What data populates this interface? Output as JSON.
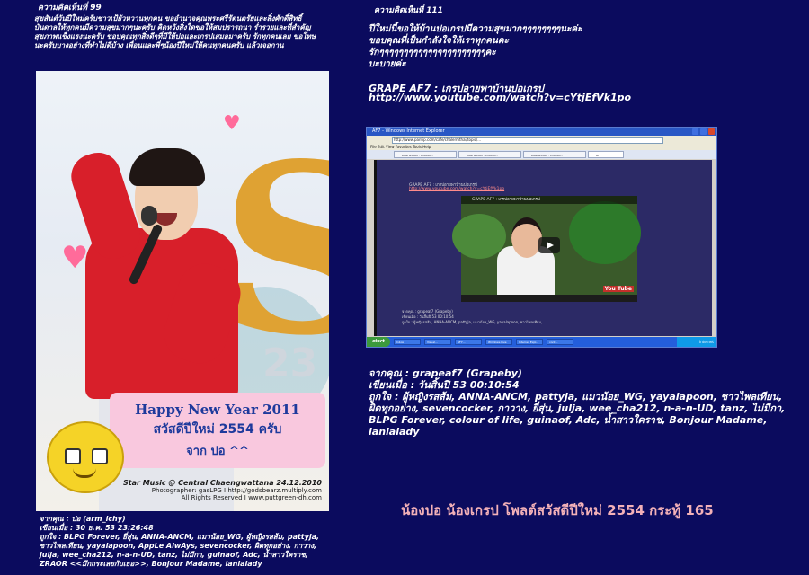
{
  "left": {
    "heading": "ความคิดเห็นที่ 99",
    "message": "สุขสันต์วันปีใหม่ครับชาวเป้ยัวหวานทุกคน ขออำนาจคุณพระศรีรัตนตรัยและสิ่งศักดิ์สิทธิ์บันดาลให้ทุกคนมีความสุขมากๆนะครับ คิดหวังสิ่งใดขอให้สมปรารถนา ร่ำรวยและที่สำคัญสุขภาพแข็งแรงนะครับ ขอบคุณทุกสิ่งดีๆที่มีให้ปอและเกรปเสมอมาครับ รักทุกคนเลย ขอโทษนะครับบางอย่างที่ทำไม่ดีบ้าง เพื่อนและพี่ๆน้องปีใหม่ให้คนทุกคนครับ แล้วเจอกาน",
    "photo": {
      "greeting_en": "Happy New Year 2011",
      "greeting_th": "สวัสดีปีใหม่ 2554 ครับ",
      "greeting_from": "จาก ปอ ^^",
      "credit_star": "Star Music @ Central Chaengwattana 24.12.2010",
      "credit_photographer": "Photographer: gasLPG I http://godsbearz.multiply.com",
      "credit_rights": "All Rights Reserved I www.puttgreen-dh.com"
    },
    "meta": [
      "จากคุณ : ปอ (arm_ichy)",
      "เขียนเมื่อ : 30 ธ.ค. 53 23:26:48",
      "ถูกใจ : BLPG Forever, ยี่สุ่น, ANNA-ANCM, แมวน้อย_WG, ผู้หญิงรสส้ม, pattyja,",
      "ชาวไพลเทียน, yayalapoon, AppLe AlwAys, sevencocker, ผิดทุกอย่าง, กาวาง,",
      "julja, wee_cha212, n-a-n-UD, tanz, ไม่มีกา, guinaof, Adc, น้ำสาวใคราช,",
      "ZRAOR <<มึกกระเลยกับเธอ>>, Bonjour Madame, lanlalady"
    ]
  },
  "right": {
    "heading": "ความคิดเห็นที่ 111",
    "message_lines": [
      "ปีใหม่นี้ขอให้บ้านปอเกรปมีความสุขมากๆๆๆๆๆๆๆๆนะค่ะ",
      "ขอบคุณที่เป็นกำลังใจให้เราทุกคนคะ",
      "รักๆๆๆๆๆๆๆๆๆๆๆๆๆๆๆๆๆๆๆๆๆๆคะ",
      "บะบายค่ะ"
    ],
    "link_title": "GRAPE AF7 : เกรปอายพาบ้านปอเกรป",
    "link_url": "http://www.youtube.com/watch?v=cYtjEfVk1po",
    "screenshot": {
      "window_title": "AF7 - Windows Internet Explorer",
      "address": "http://www.pantip.com/cafe/chalermthai/topic/...",
      "menu": "File   Edit   View   Favorites   Tools   Help",
      "tabs": [
        "PANTIP.COM : C10485...",
        "PANTIP.COM : C10485...",
        "PANTIP.COM : C10485...",
        "AF7"
      ],
      "page_title": "GRAPE AF7 : เกรปอายพาบ้านปอเกรป",
      "page_url": "http://www.youtube.com/watch?v=cYtjEfVk1po",
      "video_title": "GRAPE AF7 : เกรปอายพาบ้านปอเกรป",
      "yt_logo": "You Tube",
      "meta": [
        "จากคุณ : grapeaf7 (Grapeby)",
        "เขียนเมื่อ : วันสิ้นปี 53 00:10:54",
        "ถูกใจ : ผู้หญิงรสส้ม, ANNA-ANCM, pattyja, แมวน้อย_WG, yayalapoon, ชาวไพลเทียน, ..."
      ],
      "start_label": "start",
      "taskbar_items": [
        "Inbox",
        "Visual...",
        "AF7...",
        "Windows Live Mes...",
        "Internet Expl...",
        "cont..."
      ],
      "clock": "Internet"
    },
    "meta": [
      "จากคุณ : grapeaf7 (Grapeby)",
      "เขียนเมื่อ : วันสิ้นปี 53 00:10:54",
      "ถูกใจ : ผู้หญิงรสส้ม, ANNA-ANCM, pattyja, แมวน้อย_WG, yayalapoon, ชาวไพลเทียน,",
      "ผิดทุกอย่าง, sevencocker, กาวาง, ยี่สุ่น, julja, wee_cha212, n-a-n-UD, tanz, ไม่มีกา,",
      "BLPG Forever, colour of life, guinaof, Adc, น้ำสาวใคราช, Bonjour Madame, lanlalady"
    ],
    "footer": "น้องปอ น้องเกรป โพลต์สวัสดีปีใหม่ 2554 กระทู้ 165"
  },
  "colors": {
    "background": "#0b0b5e",
    "footer_text": "#f3b1b8",
    "greeting_box": "#f9c8de",
    "greeting_text": "#1e3a9c",
    "sweater": "#d81f2a"
  },
  "icons": [
    "heart-icon",
    "smiley-icon",
    "play-icon",
    "window-close-icon"
  ]
}
